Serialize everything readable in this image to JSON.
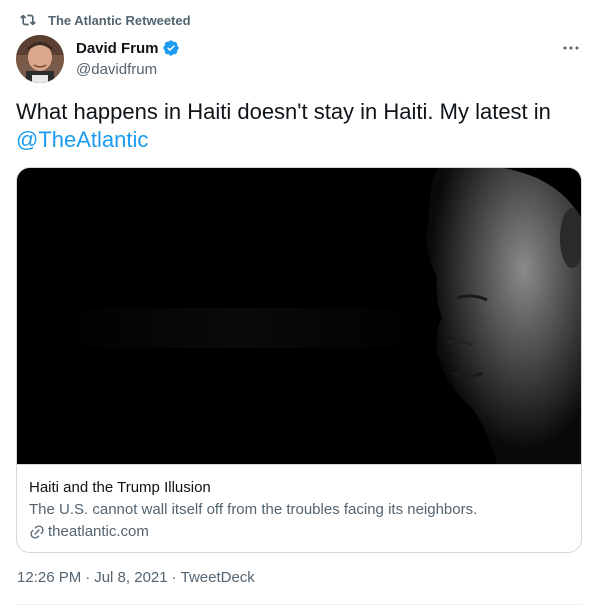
{
  "retweet_context": {
    "icon": "retweet-icon",
    "label": "The Atlantic Retweeted"
  },
  "author": {
    "display_name": "David Frum",
    "handle": "@davidfrum",
    "verified": true,
    "avatar_icon": "avatar"
  },
  "more_menu_icon": "more-options-icon",
  "tweet": {
    "text": "What happens in Haiti doesn't stay in Haiti. My latest in ",
    "mention": "@TheAtlantic"
  },
  "card": {
    "title": "Haiti and the Trump Illusion",
    "description": "The U.S. cannot wall itself off from the troubles facing its neighbors.",
    "domain": "theatlantic.com",
    "link_icon": "link-icon"
  },
  "meta": {
    "time": "12:26 PM",
    "separator": "·",
    "date": "Jul 8, 2021",
    "source": "TweetDeck"
  },
  "colors": {
    "accent": "#1d9bf0",
    "secondary_text": "#536471",
    "border": "#cfd9de"
  }
}
